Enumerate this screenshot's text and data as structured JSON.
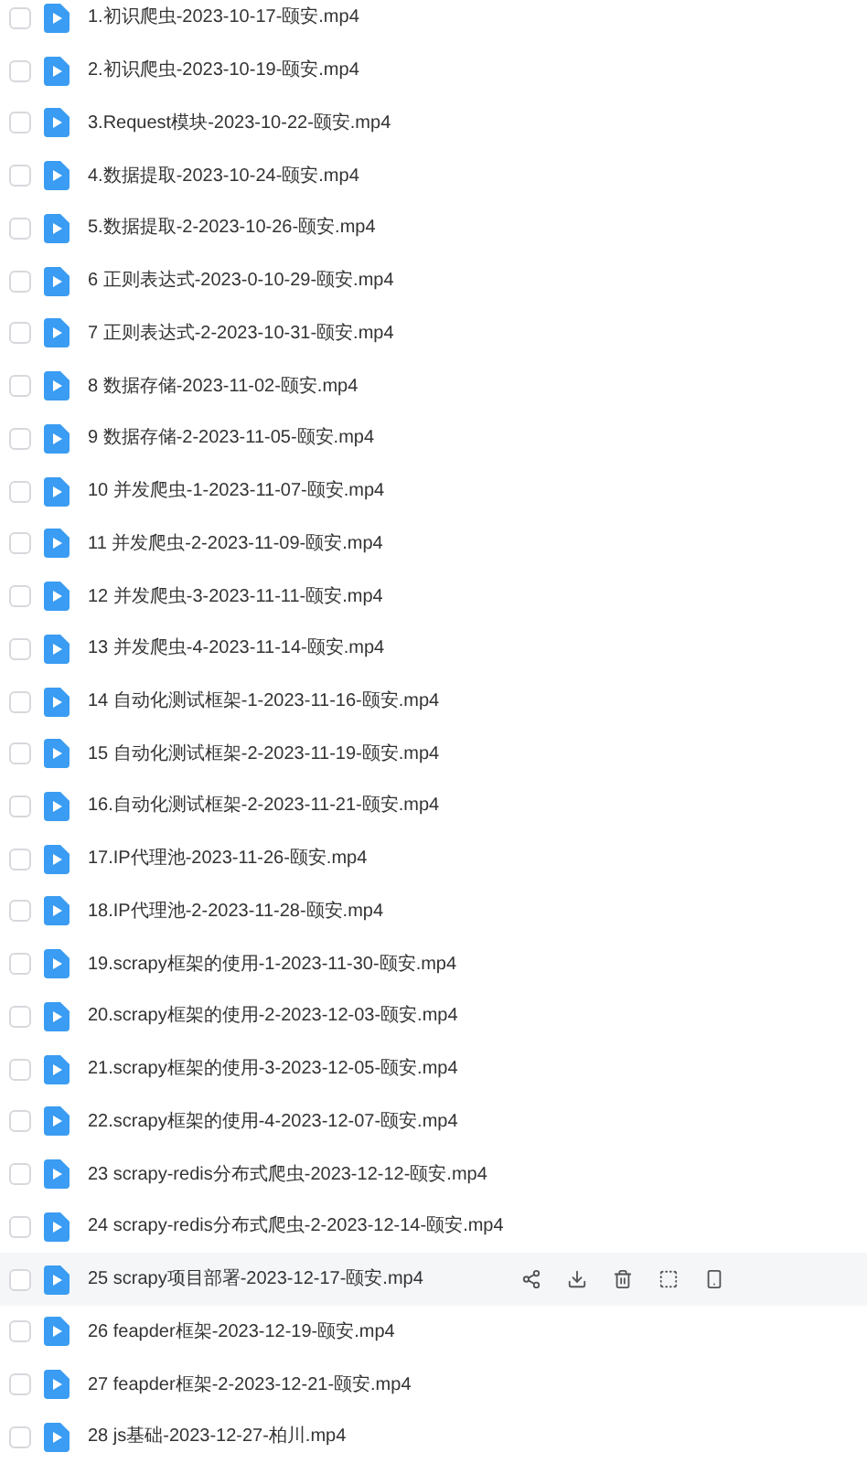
{
  "files": [
    {
      "name": "1.初识爬虫-2023-10-17-颐安.mp4",
      "checked": false,
      "hovered": false
    },
    {
      "name": "2.初识爬虫-2023-10-19-颐安.mp4",
      "checked": false,
      "hovered": false
    },
    {
      "name": "3.Request模块-2023-10-22-颐安.mp4",
      "checked": false,
      "hovered": false
    },
    {
      "name": "4.数据提取-2023-10-24-颐安.mp4",
      "checked": false,
      "hovered": false
    },
    {
      "name": "5.数据提取-2-2023-10-26-颐安.mp4",
      "checked": false,
      "hovered": false
    },
    {
      "name": "6 正则表达式-2023-0-10-29-颐安.mp4",
      "checked": false,
      "hovered": false
    },
    {
      "name": "7 正则表达式-2-2023-10-31-颐安.mp4",
      "checked": false,
      "hovered": false
    },
    {
      "name": "8 数据存储-2023-11-02-颐安.mp4",
      "checked": false,
      "hovered": false
    },
    {
      "name": "9 数据存储-2-2023-11-05-颐安.mp4",
      "checked": false,
      "hovered": false
    },
    {
      "name": "10 并发爬虫-1-2023-11-07-颐安.mp4",
      "checked": false,
      "hovered": false
    },
    {
      "name": "11 并发爬虫-2-2023-11-09-颐安.mp4",
      "checked": false,
      "hovered": false
    },
    {
      "name": "12 并发爬虫-3-2023-11-11-颐安.mp4",
      "checked": false,
      "hovered": false
    },
    {
      "name": "13 并发爬虫-4-2023-11-14-颐安.mp4",
      "checked": false,
      "hovered": false
    },
    {
      "name": "14 自动化测试框架-1-2023-11-16-颐安.mp4",
      "checked": false,
      "hovered": false
    },
    {
      "name": "15 自动化测试框架-2-2023-11-19-颐安.mp4",
      "checked": false,
      "hovered": false
    },
    {
      "name": "16.自动化测试框架-2-2023-11-21-颐安.mp4",
      "checked": false,
      "hovered": false
    },
    {
      "name": "17.IP代理池-2023-11-26-颐安.mp4",
      "checked": false,
      "hovered": false
    },
    {
      "name": "18.IP代理池-2-2023-11-28-颐安.mp4",
      "checked": false,
      "hovered": false
    },
    {
      "name": "19.scrapy框架的使用-1-2023-11-30-颐安.mp4",
      "checked": false,
      "hovered": false
    },
    {
      "name": "20.scrapy框架的使用-2-2023-12-03-颐安.mp4",
      "checked": false,
      "hovered": false
    },
    {
      "name": "21.scrapy框架的使用-3-2023-12-05-颐安.mp4",
      "checked": false,
      "hovered": false
    },
    {
      "name": "22.scrapy框架的使用-4-2023-12-07-颐安.mp4",
      "checked": false,
      "hovered": false
    },
    {
      "name": "23 scrapy-redis分布式爬虫-2023-12-12-颐安.mp4",
      "checked": false,
      "hovered": false
    },
    {
      "name": "24 scrapy-redis分布式爬虫-2-2023-12-14-颐安.mp4",
      "checked": false,
      "hovered": false
    },
    {
      "name": "25 scrapy项目部署-2023-12-17-颐安.mp4",
      "checked": false,
      "hovered": true
    },
    {
      "name": "26 feapder框架-2023-12-19-颐安.mp4",
      "checked": false,
      "hovered": false
    },
    {
      "name": "27 feapder框架-2-2023-12-21-颐安.mp4",
      "checked": false,
      "hovered": false
    },
    {
      "name": "28 js基础-2023-12-27-柏川.mp4",
      "checked": false,
      "hovered": false
    }
  ]
}
